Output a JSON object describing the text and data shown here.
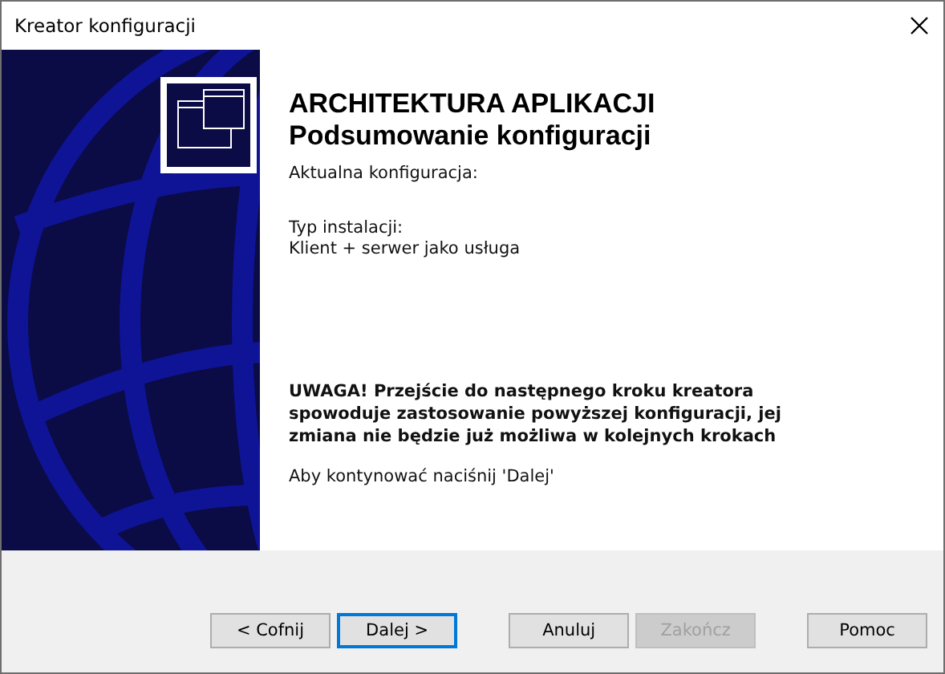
{
  "window": {
    "title": "Kreator konfiguracji"
  },
  "header": {
    "title": "ARCHITEKTURA APLIKACJI",
    "subtitle": "Podsumowanie konfiguracji"
  },
  "body": {
    "current_label": "Aktualna konfiguracja:",
    "install_type_label": "Typ instalacji:",
    "install_type_value": "Klient + serwer jako usługa",
    "warning": "UWAGA! Przejście do następnego kroku kreatora spowoduje zastosowanie powyższej konfiguracji, jej zmiana nie będzie już możliwa w kolejnych krokach",
    "hint": "Aby kontynować naciśnij 'Dalej'"
  },
  "buttons": [
    {
      "label": "< Cofnij",
      "focused": false,
      "disabled": false
    },
    {
      "label": "Dalej >",
      "focused": true,
      "disabled": false
    },
    {
      "label": "Anuluj",
      "focused": false,
      "disabled": false
    },
    {
      "label": "Zakończ",
      "focused": false,
      "disabled": true
    },
    {
      "label": "Pomoc",
      "focused": false,
      "disabled": false
    }
  ]
}
